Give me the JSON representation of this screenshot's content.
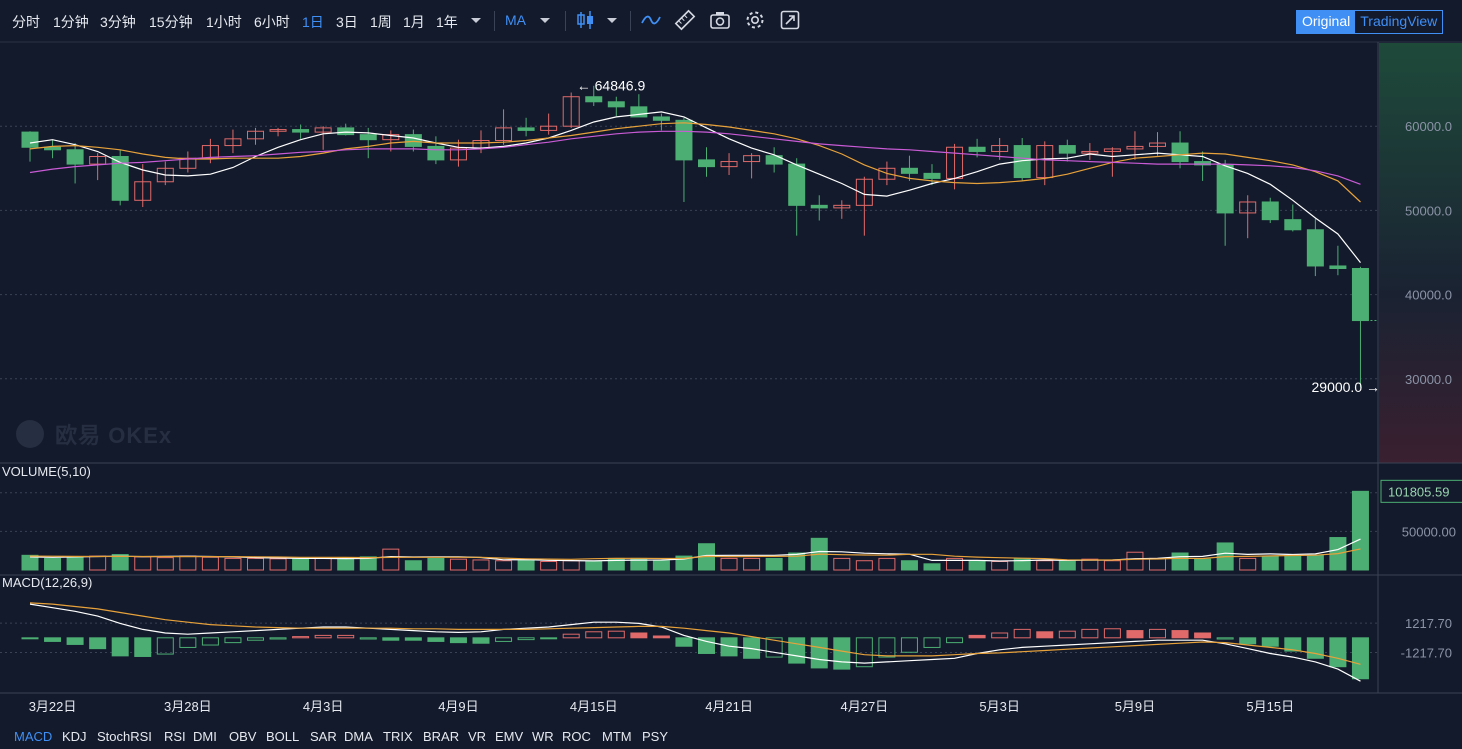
{
  "toolbar": {
    "intervals": [
      "分时",
      "1分钟",
      "3分钟",
      "15分钟",
      "1小时",
      "6小时",
      "1日",
      "3日",
      "1周",
      "1月",
      "1年"
    ],
    "active_interval": "1日",
    "indicator": "MA",
    "modes": {
      "original": "Original",
      "tradingview": "TradingView",
      "active": "Original"
    },
    "icons": [
      "dropdown-icon",
      "candle-type-icon",
      "dropdown-icon",
      "line-draw-icon",
      "ruler-icon",
      "camera-icon",
      "settings-icon",
      "fullscreen-icon"
    ]
  },
  "watermark": "欧易 OKEx",
  "colors": {
    "up": "#e06a6a",
    "down": "#4cae73",
    "bg": "#131a2b",
    "ma_white": "#ffffff",
    "ma_orange": "#e8a23b",
    "ma_purple": "#c95bd6",
    "accent": "#3f8ff5"
  },
  "chart_data": [
    {
      "type": "candlestick",
      "name": "price",
      "ylim": [
        20000,
        70000
      ],
      "y_ticks": [
        30000,
        40000,
        50000,
        60000
      ],
      "y_tick_labels": [
        "30000.0",
        "40000.0",
        "50000.0",
        "60000.0"
      ],
      "x_tick_labels": [
        {
          "i": 1,
          "label": "3月22日"
        },
        {
          "i": 7,
          "label": "3月28日"
        },
        {
          "i": 13,
          "label": "4月3日"
        },
        {
          "i": 19,
          "label": "4月9日"
        },
        {
          "i": 25,
          "label": "4月15日"
        },
        {
          "i": 31,
          "label": "4月21日"
        },
        {
          "i": 37,
          "label": "4月27日"
        },
        {
          "i": 43,
          "label": "5月3日"
        },
        {
          "i": 49,
          "label": "5月9日"
        },
        {
          "i": 55,
          "label": "5月15日"
        }
      ],
      "current_price": "36917.5",
      "high_label": {
        "i": 25,
        "value": 64846.9,
        "text": "64846.9"
      },
      "low_label": {
        "i": 60,
        "value": 29000.0,
        "text": "29000.0"
      },
      "ohlc": [
        [
          59300,
          59400,
          55800,
          57500
        ],
        [
          57500,
          58400,
          56200,
          57200
        ],
        [
          57200,
          58000,
          53200,
          55500
        ],
        [
          55500,
          56800,
          53600,
          56400
        ],
        [
          56400,
          57200,
          50600,
          51200
        ],
        [
          51200,
          55500,
          50400,
          53400
        ],
        [
          53400,
          55800,
          53000,
          55000
        ],
        [
          55000,
          57000,
          54500,
          56200
        ],
        [
          56200,
          58500,
          55600,
          57700
        ],
        [
          57700,
          59600,
          56800,
          58500
        ],
        [
          58500,
          59800,
          57800,
          59400
        ],
        [
          59400,
          59800,
          58800,
          59600
        ],
        [
          59600,
          60200,
          58500,
          59300
        ],
        [
          59300,
          60000,
          57200,
          59800
        ],
        [
          59800,
          60300,
          58900,
          59000
        ],
        [
          59000,
          59800,
          56200,
          58400
        ],
        [
          58400,
          59500,
          57000,
          59000
        ],
        [
          59000,
          59600,
          57000,
          57600
        ],
        [
          57600,
          58800,
          55500,
          56000
        ],
        [
          56000,
          58400,
          55200,
          57400
        ],
        [
          57400,
          59500,
          56800,
          58300
        ],
        [
          58300,
          62000,
          57800,
          59800
        ],
        [
          59800,
          61000,
          58800,
          59500
        ],
        [
          59500,
          61500,
          59000,
          60000
        ],
        [
          60000,
          64000,
          59800,
          63500
        ],
        [
          63500,
          64800,
          62400,
          62900
        ],
        [
          62900,
          63500,
          61200,
          62300
        ],
        [
          62300,
          63800,
          61800,
          61100
        ],
        [
          61100,
          61500,
          59500,
          60700
        ],
        [
          60700,
          61000,
          51000,
          56000
        ],
        [
          56000,
          57500,
          54000,
          55200
        ],
        [
          55200,
          56800,
          54200,
          55800
        ],
        [
          55800,
          56800,
          53800,
          56500
        ],
        [
          56500,
          57500,
          54500,
          55500
        ],
        [
          55500,
          56200,
          47000,
          50600
        ],
        [
          50600,
          51800,
          48800,
          50300
        ],
        [
          50300,
          51200,
          49000,
          50600
        ],
        [
          50600,
          54000,
          47000,
          53700
        ],
        [
          53700,
          55800,
          53000,
          55000
        ],
        [
          55000,
          56500,
          53500,
          54400
        ],
        [
          54400,
          55500,
          53000,
          53800
        ],
        [
          53800,
          57900,
          52500,
          57500
        ],
        [
          57500,
          58500,
          56300,
          57000
        ],
        [
          57000,
          58600,
          56000,
          57700
        ],
        [
          57700,
          58600,
          53500,
          53900
        ],
        [
          53900,
          58200,
          53000,
          57700
        ],
        [
          57700,
          58400,
          55800,
          56800
        ],
        [
          56800,
          58000,
          56000,
          57000
        ],
        [
          57000,
          57500,
          54000,
          57300
        ],
        [
          57300,
          59400,
          56000,
          57600
        ],
        [
          57600,
          59300,
          56500,
          58000
        ],
        [
          58000,
          59400,
          55000,
          55800
        ],
        [
          55800,
          57000,
          53500,
          55400
        ],
        [
          55400,
          56000,
          45800,
          49700
        ],
        [
          49700,
          51800,
          46700,
          51000
        ],
        [
          51000,
          51500,
          48500,
          48900
        ],
        [
          48900,
          50700,
          47500,
          47700
        ],
        [
          47700,
          49000,
          42200,
          43400
        ],
        [
          43400,
          45800,
          42300,
          43100
        ],
        [
          43100,
          43300,
          29000,
          36917.5
        ]
      ],
      "ma": [
        {
          "name": "MA5",
          "color": "#ffffff",
          "values": [
            58000,
            58400,
            57800,
            57000,
            55700,
            54800,
            54200,
            54100,
            54300,
            55100,
            56400,
            57500,
            58400,
            59100,
            59300,
            59200,
            58900,
            58600,
            58000,
            57500,
            57400,
            57600,
            58000,
            58600,
            59500,
            60500,
            61100,
            61400,
            61700,
            61100,
            59800,
            58500,
            57400,
            56600,
            55400,
            54300,
            53200,
            51900,
            51700,
            52400,
            53200,
            53800,
            54600,
            55500,
            55900,
            56100,
            56200,
            56700,
            56400,
            56600,
            56800,
            56600,
            56400,
            55300,
            54400,
            53100,
            51200,
            49100,
            47200,
            43800
          ]
        },
        {
          "name": "MA10",
          "color": "#e8a23b",
          "values": [
            57300,
            57600,
            57700,
            57500,
            57200,
            56700,
            56300,
            56100,
            56100,
            56200,
            56200,
            56200,
            56400,
            56800,
            57300,
            57600,
            58000,
            58200,
            58000,
            58000,
            58000,
            58100,
            58300,
            58600,
            58900,
            59300,
            59700,
            60000,
            60300,
            60400,
            60200,
            59900,
            59500,
            59100,
            58500,
            57700,
            56700,
            55400,
            54400,
            53800,
            53500,
            53300,
            53200,
            53300,
            53500,
            53800,
            54300,
            55000,
            55700,
            56200,
            56400,
            56600,
            56800,
            56700,
            56300,
            55900,
            55400,
            54600,
            53500,
            51000
          ]
        },
        {
          "name": "MA30",
          "color": "#c95bd6",
          "values": [
            54500,
            54900,
            55200,
            55400,
            55600,
            55700,
            55900,
            56100,
            56300,
            56400,
            56500,
            56700,
            56900,
            57000,
            57200,
            57300,
            57300,
            57300,
            57200,
            57200,
            57300,
            57500,
            57800,
            58100,
            58500,
            58800,
            59100,
            59300,
            59400,
            59400,
            59300,
            59100,
            58800,
            58500,
            58200,
            57900,
            57700,
            57500,
            57300,
            57200,
            57000,
            56800,
            56600,
            56400,
            56200,
            56000,
            55900,
            55800,
            55700,
            55600,
            55500,
            55500,
            55500,
            55500,
            55400,
            55300,
            55100,
            54700,
            54100,
            53100
          ]
        }
      ]
    },
    {
      "type": "bar",
      "name": "VOLUME(5,10)",
      "title": "VOLUME(5,10)",
      "ylim": [
        0,
        110000
      ],
      "y_tick": 50000,
      "y_tick_label": "50000.00",
      "current_value": "101805.59",
      "values": [
        19000,
        15000,
        17000,
        18000,
        20000,
        17000,
        16000,
        18000,
        16500,
        15000,
        15000,
        14500,
        14000,
        15000,
        14000,
        17000,
        27000,
        12000,
        15000,
        14000,
        13000,
        12000,
        13000,
        11000,
        12000,
        11000,
        15000,
        15000,
        12000,
        18000,
        34000,
        15000,
        15000,
        15000,
        22000,
        41000,
        15000,
        12000,
        15000,
        12000,
        8000,
        15000,
        12000,
        11000,
        15000,
        12000,
        12000,
        14000,
        12000,
        23000,
        15000,
        22000,
        14000,
        35000,
        15000,
        18000,
        18000,
        19000,
        42000,
        101805.59
      ],
      "ma": [
        {
          "name": "MA5",
          "color": "#ffffff",
          "values": [
            17000,
            16500,
            17000,
            17500,
            17800,
            17400,
            17600,
            17800,
            17500,
            17000,
            16000,
            15500,
            15000,
            15000,
            14700,
            15000,
            17400,
            16800,
            17000,
            17000,
            16200,
            13200,
            13400,
            12600,
            12200,
            11800,
            12400,
            12800,
            13000,
            14200,
            18800,
            19000,
            19000,
            19000,
            20200,
            24000,
            23600,
            21800,
            21000,
            20400,
            12400,
            12400,
            12400,
            11600,
            12200,
            13000,
            12400,
            12800,
            13000,
            14600,
            15200,
            17200,
            17600,
            21800,
            20200,
            20800,
            20000,
            20800,
            26400,
            40000
          ]
        },
        {
          "name": "MA10",
          "color": "#e8a23b",
          "values": [
            18000,
            17800,
            17600,
            17500,
            17600,
            17500,
            17300,
            17300,
            17300,
            17300,
            17100,
            16800,
            16500,
            16400,
            16300,
            16100,
            16300,
            16400,
            16400,
            16500,
            16400,
            15400,
            14500,
            14100,
            13900,
            14600,
            15000,
            15100,
            14900,
            15000,
            17600,
            17400,
            17500,
            17600,
            17900,
            20600,
            19800,
            19400,
            19100,
            20300,
            20300,
            17900,
            16700,
            15900,
            15300,
            14800,
            13200,
            13000,
            12900,
            13900,
            14200,
            15200,
            14900,
            17300,
            17600,
            18200,
            18700,
            19200,
            21200,
            27300
          ]
        }
      ]
    },
    {
      "type": "bar",
      "name": "MACD(12,26,9)",
      "title": "MACD(12,26,9)",
      "ylim": [
        -4500,
        4800
      ],
      "y_ticks": [
        1217.7,
        -1217.7
      ],
      "y_tick_labels": [
        "1217.70",
        "-1217.70"
      ],
      "hist": [
        -80,
        -300,
        -550,
        -900,
        -1500,
        -1550,
        -1350,
        -800,
        -600,
        -400,
        -200,
        -100,
        100,
        200,
        200,
        -100,
        -200,
        -200,
        -300,
        -400,
        -450,
        -300,
        -150,
        -50,
        300,
        500,
        550,
        400,
        150,
        -700,
        -1300,
        -1500,
        -1700,
        -1600,
        -2100,
        -2500,
        -2600,
        -2400,
        -1600,
        -1200,
        -800,
        -400,
        200,
        400,
        700,
        500,
        550,
        700,
        750,
        600,
        700,
        600,
        400,
        -100,
        -500,
        -700,
        -1100,
        -1700,
        -2400,
        -3400
      ],
      "dif": [
        2800,
        2500,
        2200,
        1800,
        1200,
        700,
        400,
        300,
        400,
        500,
        600,
        700,
        800,
        900,
        900,
        800,
        700,
        600,
        500,
        450,
        500,
        700,
        800,
        900,
        1100,
        1300,
        1300,
        1200,
        900,
        200,
        -300,
        -700,
        -900,
        -1200,
        -1500,
        -1800,
        -2000,
        -2100,
        -2000,
        -1900,
        -1800,
        -1700,
        -1300,
        -1000,
        -800,
        -700,
        -600,
        -500,
        -400,
        -300,
        -200,
        -200,
        -200,
        -500,
        -900,
        -1300,
        -1600,
        -2000,
        -2600,
        -3600
      ],
      "dea": [
        2900,
        2800,
        2600,
        2400,
        2100,
        1800,
        1500,
        1300,
        1100,
        1000,
        900,
        850,
        800,
        800,
        800,
        800,
        800,
        750,
        750,
        700,
        700,
        700,
        700,
        750,
        800,
        850,
        900,
        950,
        950,
        800,
        600,
        400,
        100,
        -200,
        -500,
        -800,
        -1100,
        -1400,
        -1500,
        -1500,
        -1500,
        -1400,
        -1300,
        -1250,
        -1150,
        -1050,
        -950,
        -850,
        -750,
        -650,
        -550,
        -450,
        -350,
        -400,
        -600,
        -800,
        -1000,
        -1300,
        -1700,
        -2200
      ]
    }
  ],
  "x_labels_axis": "date",
  "bottom_indicators": [
    "MACD",
    "KDJ",
    "StochRSI",
    "RSI",
    "DMI",
    "OBV",
    "BOLL",
    "SAR",
    "DMA",
    "TRIX",
    "BRAR",
    "VR",
    "EMV",
    "WR",
    "ROC",
    "MTM",
    "PSY"
  ],
  "active_bottom_indicator": "MACD"
}
